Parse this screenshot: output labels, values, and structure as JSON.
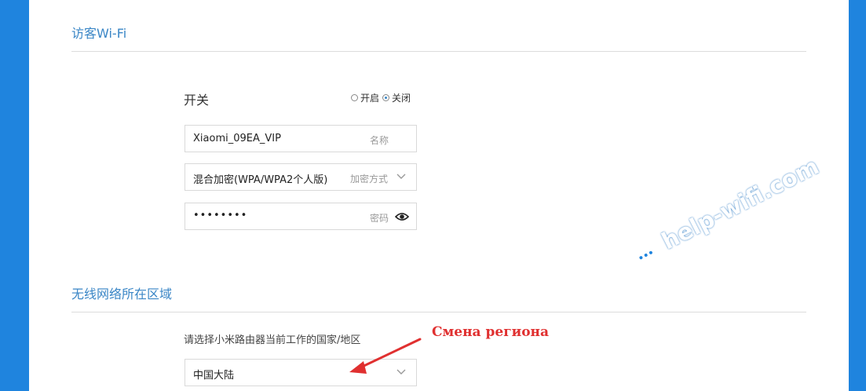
{
  "guest_wifi": {
    "section_title": "访客Wi-Fi",
    "switch_label": "开关",
    "radio_on_label": "开启",
    "radio_off_label": "关闭",
    "selected": "关闭",
    "ssid_value": "Xiaomi_09EA_VIP",
    "ssid_hint": "名称",
    "encryption_value": "混合加密(WPA/WPA2个人版)",
    "encryption_hint": "加密方式",
    "password_value": "••••••••",
    "password_hint": "密码"
  },
  "region": {
    "section_title": "无线网络所在区域",
    "instruction": "请选择小米路由器当前工作的国家/地区",
    "selected_value": "中国大陆"
  },
  "annotation": {
    "text": "Смена региона",
    "color": "#e03030"
  },
  "watermark": {
    "text": "help-wifi.com"
  },
  "colors": {
    "background": "#1f84de",
    "accent": "#3a86c6"
  }
}
